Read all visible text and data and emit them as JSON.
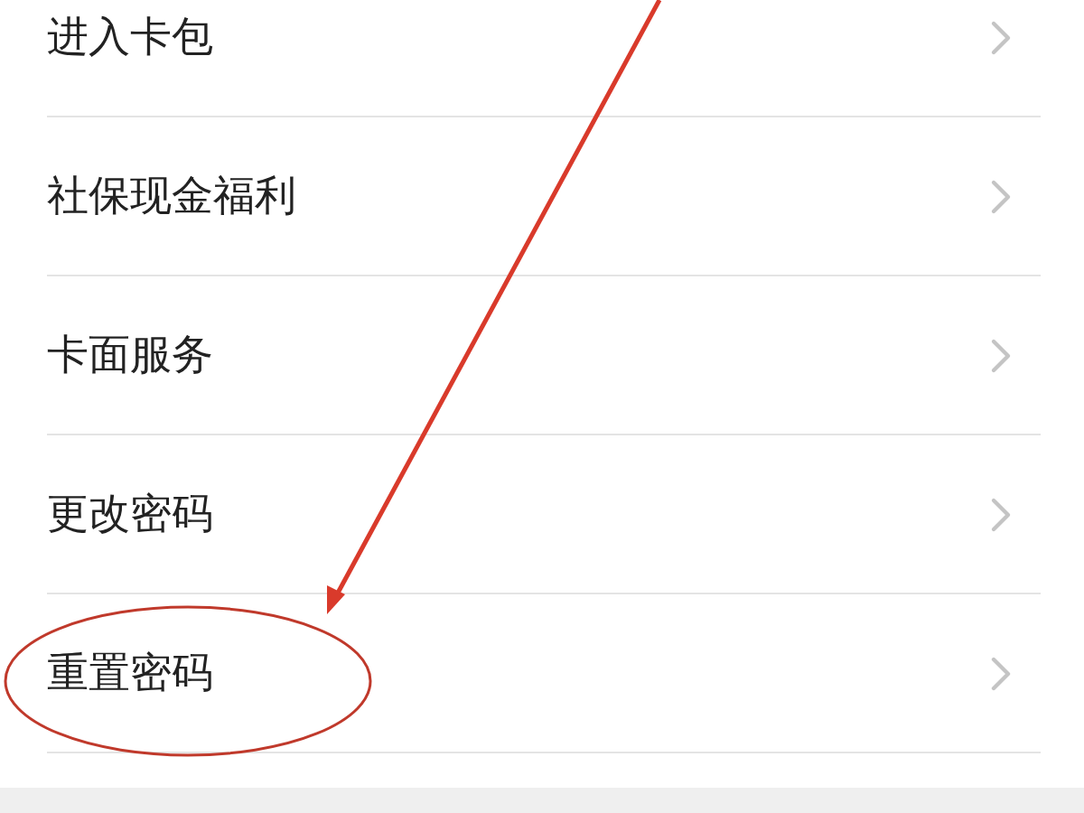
{
  "menu_items": [
    {
      "label": "进入卡包",
      "circled": false
    },
    {
      "label": "社保现金福利",
      "circled": false
    },
    {
      "label": "卡面服务",
      "circled": false
    },
    {
      "label": "更改密码",
      "circled": false
    },
    {
      "label": "重置密码",
      "circled": true
    }
  ]
}
